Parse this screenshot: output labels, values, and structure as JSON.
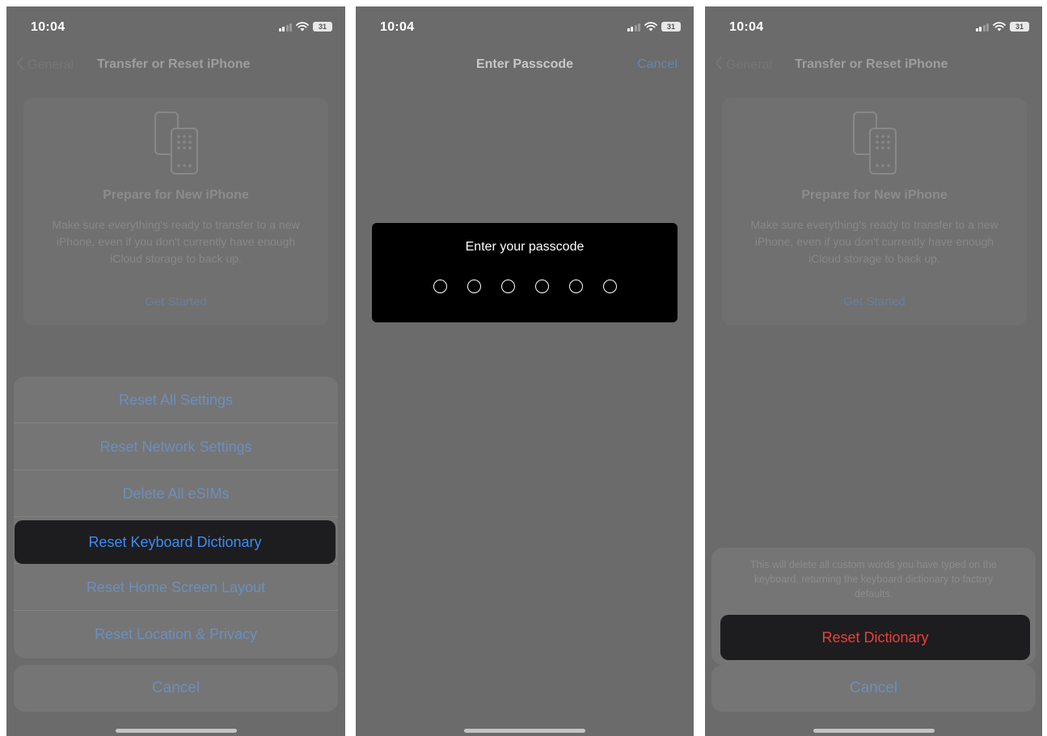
{
  "status": {
    "time": "10:04",
    "battery": "31"
  },
  "screen1": {
    "nav": {
      "back": "General",
      "title": "Transfer or Reset iPhone"
    },
    "card": {
      "title": "Prepare for New iPhone",
      "description": "Make sure everything's ready to transfer to a new iPhone, even if you don't currently have enough iCloud storage to back up.",
      "link": "Get Started"
    },
    "sheet": [
      "Reset All Settings",
      "Reset Network Settings",
      "Delete All eSIMs",
      "Reset Keyboard Dictionary",
      "Reset Home Screen Layout",
      "Reset Location & Privacy"
    ],
    "highlighted": "Reset Keyboard Dictionary",
    "cancel": "Cancel"
  },
  "screen2": {
    "nav": {
      "title": "Enter Passcode",
      "cancel": "Cancel"
    },
    "prompt": "Enter your passcode",
    "digits": 6
  },
  "screen3": {
    "nav": {
      "back": "General",
      "title": "Transfer or Reset iPhone"
    },
    "card": {
      "title": "Prepare for New iPhone",
      "description": "Make sure everything's ready to transfer to a new iPhone, even if you don't currently have enough iCloud storage to back up.",
      "link": "Get Started"
    },
    "confirm_message": "This will delete all custom words you have typed on the keyboard, returning the keyboard dictionary to factory defaults.",
    "confirm_button": "Reset Dictionary",
    "cancel": "Cancel"
  },
  "colors": {
    "accent_blue": "#3d8bf5",
    "destructive_red": "#e8413c",
    "dim_overlay": "#6b6b6b"
  },
  "icons": [
    "signal-icon",
    "wifi-icon",
    "battery-icon",
    "chevron-left-icon",
    "phone-transfer-icon"
  ]
}
